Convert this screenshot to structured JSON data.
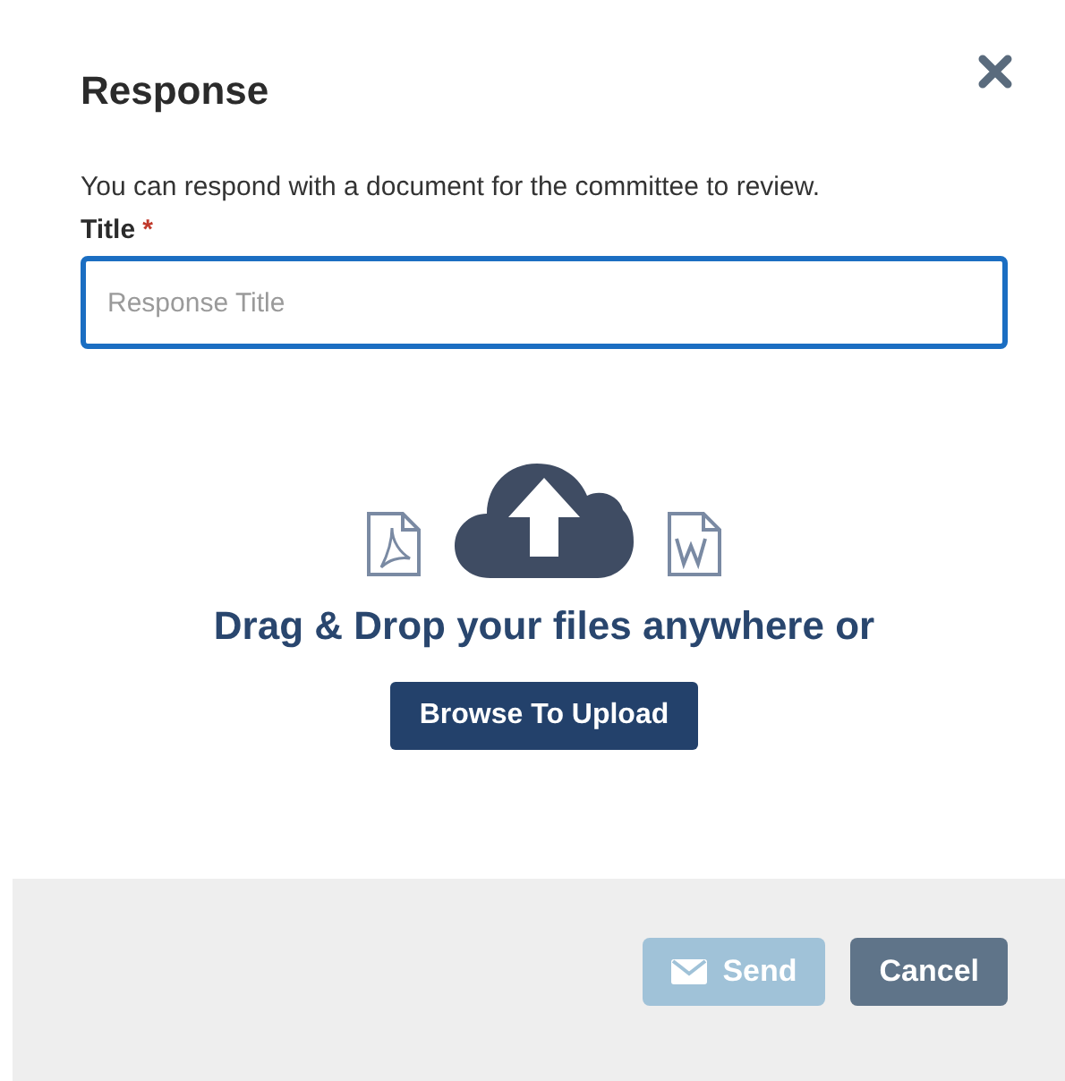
{
  "dialog": {
    "title": "Response",
    "intro": "You can respond with a document for the committee to review.",
    "field": {
      "label": "Title",
      "required_mark": "*",
      "placeholder": "Response Title",
      "focused": true
    },
    "upload": {
      "prompt": "Drag & Drop your files anywhere or",
      "button": "Browse To Upload"
    },
    "buttons": [
      {
        "kind": "send",
        "label": "Send",
        "disabled": true
      },
      {
        "kind": "cancel",
        "label": "Cancel",
        "disabled": false
      }
    ]
  }
}
